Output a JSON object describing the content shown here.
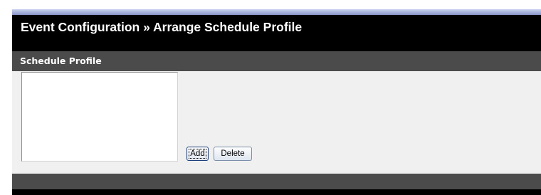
{
  "header": {
    "title": "Event Configuration » Arrange Schedule Profile"
  },
  "panel": {
    "title": "Schedule Profile",
    "list_items": []
  },
  "buttons": {
    "add_label": "Add",
    "delete_label": "Delete"
  },
  "colors": {
    "background": "#000000",
    "panel_header": "#4b4b4b",
    "panel_body": "#f0f0f0",
    "top_strip": "#8796c8"
  }
}
